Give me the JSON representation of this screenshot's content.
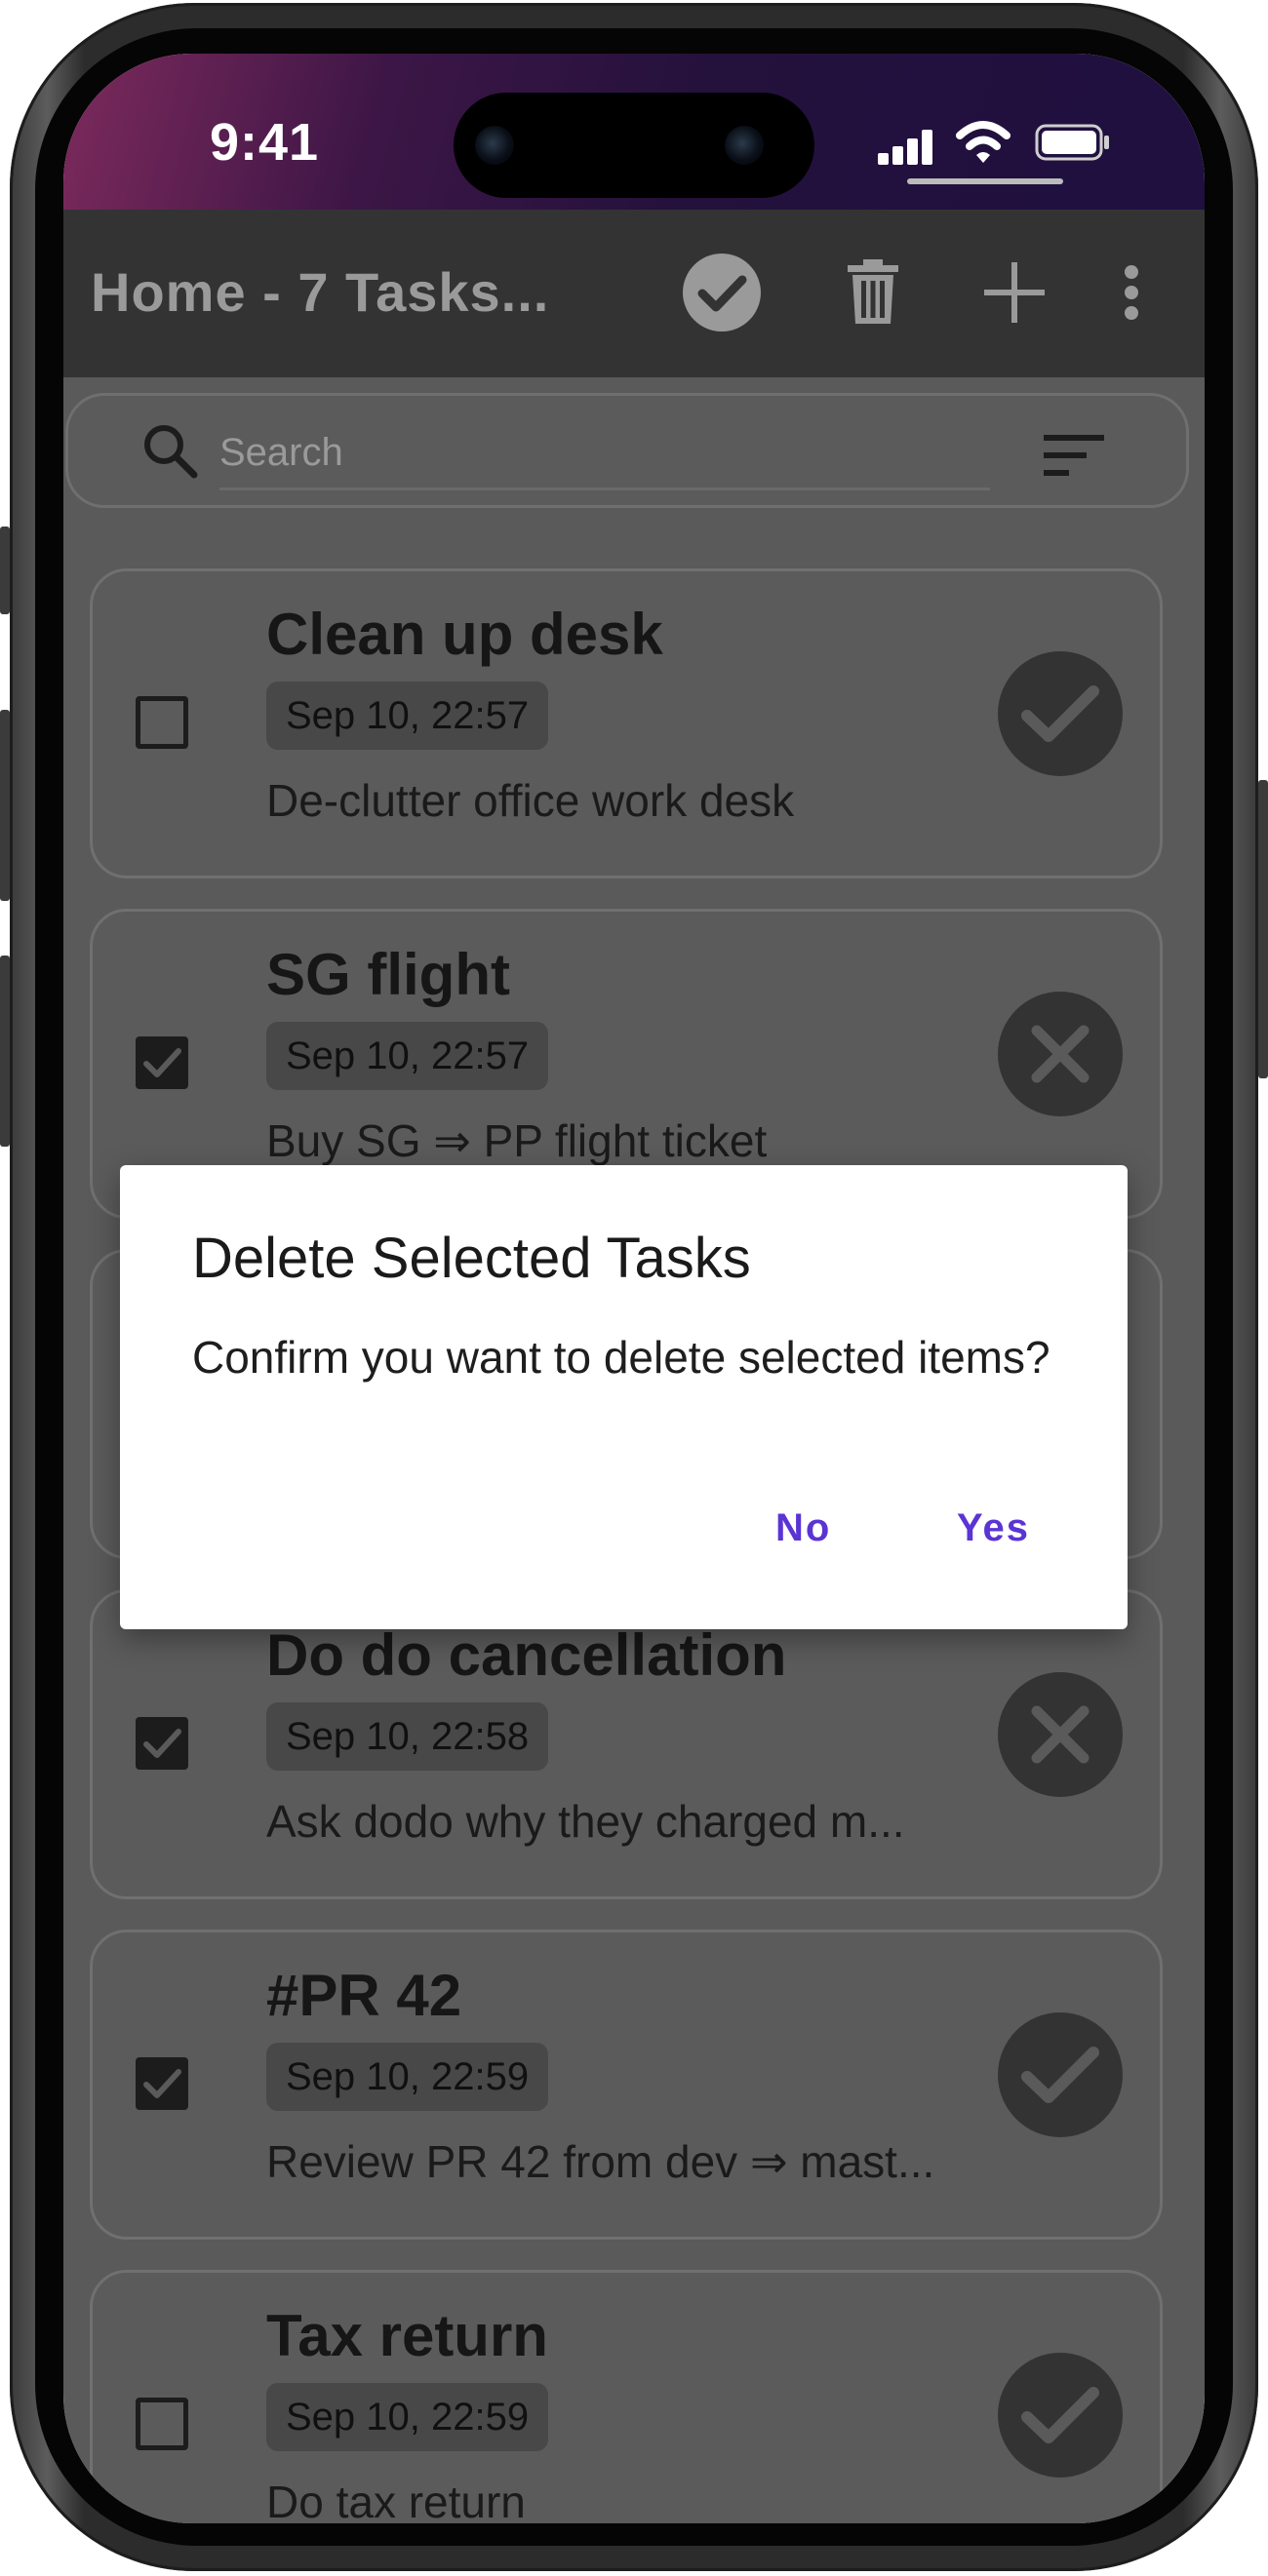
{
  "status_bar": {
    "time": "9:41"
  },
  "app_bar": {
    "title": "Home - 7 Tasks...",
    "icons": [
      "check-circle-icon",
      "trash-icon",
      "plus-icon",
      "more-vert-icon"
    ]
  },
  "search": {
    "placeholder": "Search"
  },
  "tasks": [
    {
      "title": "Clean up desk",
      "date": "Sep 10, 22:57",
      "description": "De-clutter office work desk",
      "checked": false,
      "action": "check-icon"
    },
    {
      "title": "SG flight",
      "date": "Sep 10, 22:57",
      "description": "Buy SG ⇒ PP flight ticket",
      "checked": true,
      "action": "close-icon"
    },
    {
      "title": "",
      "date": "",
      "description": "",
      "checked": false,
      "action": ""
    },
    {
      "title": "Do do cancellation",
      "date": "Sep 10, 22:58",
      "description": "Ask dodo why they charged m...",
      "checked": true,
      "action": "close-icon"
    },
    {
      "title": "#PR 42",
      "date": "Sep 10, 22:59",
      "description": "Review PR 42 from dev ⇒ mast...",
      "checked": true,
      "action": "check-icon"
    },
    {
      "title": "Tax return",
      "date": "Sep 10, 22:59",
      "description": "Do tax return",
      "checked": false,
      "action": "check-icon"
    }
  ],
  "dialog": {
    "title": "Delete Selected Tasks",
    "message": "Confirm you want to delete selected items?",
    "no_label": "No",
    "yes_label": "Yes"
  },
  "colors": {
    "accent": "#5b34d4",
    "app_bar": "#333333",
    "scrim": "#5a5a5a"
  }
}
